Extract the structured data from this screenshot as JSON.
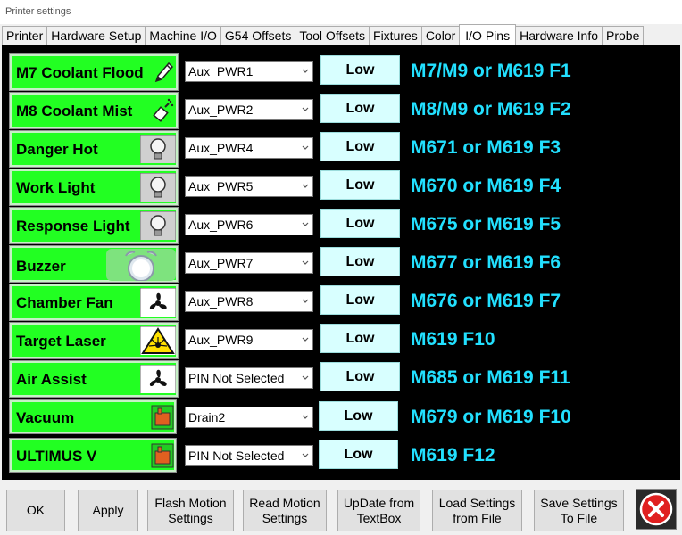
{
  "window": {
    "title": "Printer settings"
  },
  "tabs": [
    {
      "label": "Printer",
      "active": false
    },
    {
      "label": "Hardware Setup",
      "active": false
    },
    {
      "label": "Machine I/O",
      "active": false
    },
    {
      "label": "G54 Offsets",
      "active": false
    },
    {
      "label": "Tool Offsets",
      "active": false
    },
    {
      "label": "Fixtures",
      "active": false
    },
    {
      "label": "Color",
      "active": false
    },
    {
      "label": "I/O Pins",
      "active": true
    },
    {
      "label": "Hardware Info",
      "active": false
    },
    {
      "label": "Probe",
      "active": false
    }
  ],
  "pins": [
    {
      "name": "M7 Coolant Flood",
      "icon": "pencil-icon",
      "pin": "Aux_PWR1",
      "state": "Low",
      "code": "M7/M9 or M619 F1"
    },
    {
      "name": "M8 Coolant Mist",
      "icon": "spray-icon",
      "pin": "Aux_PWR2",
      "state": "Low",
      "code": "M8/M9 or M619 F2"
    },
    {
      "name": "Danger Hot",
      "icon": "lightbulb-icon",
      "pin": "Aux_PWR4",
      "state": "Low",
      "code": "M671 or M619 F3"
    },
    {
      "name": "Work Light",
      "icon": "lightbulb-icon",
      "pin": "Aux_PWR5",
      "state": "Low",
      "code": "M670 or M619 F4"
    },
    {
      "name": "Response Light",
      "icon": "lightbulb-icon",
      "pin": "Aux_PWR6",
      "state": "Low",
      "code": "M675 or M619 F5"
    },
    {
      "name": "Buzzer",
      "icon": "alarm-clock-icon",
      "pin": "Aux_PWR7",
      "state": "Low",
      "code": "M677 or M619 F6"
    },
    {
      "name": "Chamber Fan",
      "icon": "fan-icon",
      "pin": "Aux_PWR8",
      "state": "Low",
      "code": "M676 or M619 F7"
    },
    {
      "name": "Target Laser",
      "icon": "laser-warning-icon",
      "pin": "Aux_PWR9",
      "state": "Low",
      "code": "M619 F10"
    },
    {
      "name": "Air Assist",
      "icon": "fan-icon",
      "pin": "PIN Not Selected",
      "state": "Low",
      "code": "M685 or M619 F11"
    },
    {
      "name": "Vacuum",
      "icon": "bin-icon",
      "pin": "Drain2",
      "state": "Low",
      "code": "M679 or M619 F10"
    },
    {
      "name": "ULTIMUS V",
      "icon": "bin-icon",
      "pin": "PIN Not Selected",
      "state": "Low",
      "code": "M619 F12"
    }
  ],
  "buttons": {
    "ok": "OK",
    "apply": "Apply",
    "flash_motion": [
      "Flash Motion",
      "Settings"
    ],
    "read_motion": [
      "Read Motion",
      "Settings"
    ],
    "update_textbox": [
      "UpDate from",
      "TextBox"
    ],
    "load_settings": [
      "Load Settings",
      "from File"
    ],
    "save_settings": [
      "Save Settings",
      "To File"
    ]
  },
  "colors": {
    "name_button": "#22ff22",
    "state_button": "#d8ffff",
    "code_text": "#22e0ff",
    "panel_bg": "#000000",
    "close_red": "#e02020"
  }
}
